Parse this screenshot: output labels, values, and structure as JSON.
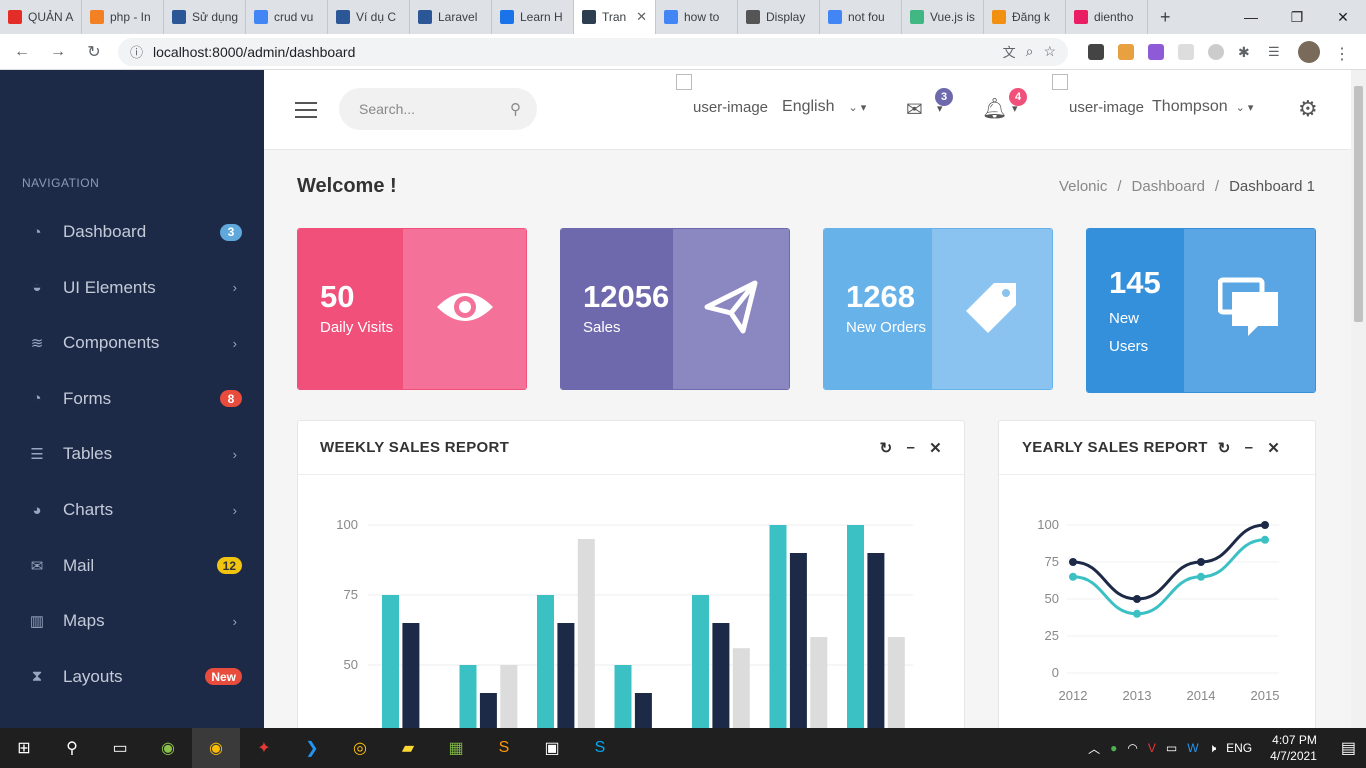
{
  "browser": {
    "tabs": [
      {
        "label": "QUẢN A",
        "color": "#e52d27"
      },
      {
        "label": "php - In",
        "color": "#f48024"
      },
      {
        "label": "Sử dụng",
        "color": "#2b5797"
      },
      {
        "label": "crud vu",
        "color": "#4285f4"
      },
      {
        "label": "Ví dụ C",
        "color": "#2b5797"
      },
      {
        "label": "Laravel",
        "color": "#2b5797"
      },
      {
        "label": "Learn H",
        "color": "#1a73e8"
      },
      {
        "label": "Tran",
        "color": "#2c3e50",
        "active": true
      },
      {
        "label": "how to",
        "color": "#4285f4"
      },
      {
        "label": "Display",
        "color": "#555555"
      },
      {
        "label": "not fou",
        "color": "#4285f4"
      },
      {
        "label": "Vue.js is",
        "color": "#41b883"
      },
      {
        "label": "Đăng k",
        "color": "#f29111"
      },
      {
        "label": "dientho",
        "color": "#e91e63"
      }
    ],
    "url": "localhost:8000/admin/dashboard"
  },
  "sidebar": {
    "section_label": "NAVIGATION",
    "items": [
      {
        "label": "Dashboard",
        "icon": "dashboard-icon",
        "glyph": "◔",
        "badge": "3",
        "badge_color": "#5fa8dc",
        "chev": ""
      },
      {
        "label": "UI Elements",
        "icon": "basket-icon",
        "glyph": "◒",
        "badge": "",
        "chev": "›"
      },
      {
        "label": "Components",
        "icon": "layers-icon",
        "glyph": "≋",
        "badge": "",
        "chev": "›"
      },
      {
        "label": "Forms",
        "icon": "dashboard-icon",
        "glyph": "◔",
        "badge": "8",
        "badge_color": "#e74c3c",
        "chev": ""
      },
      {
        "label": "Tables",
        "icon": "list-icon",
        "glyph": "☰",
        "badge": "",
        "chev": "›"
      },
      {
        "label": "Charts",
        "icon": "pie-chart-icon",
        "glyph": "◕",
        "badge": "",
        "chev": "›"
      },
      {
        "label": "Mail",
        "icon": "mail-icon",
        "glyph": "✉",
        "badge": "12",
        "badge_color": "#f1c40f",
        "badge_text_color": "#333333",
        "chev": ""
      },
      {
        "label": "Maps",
        "icon": "map-icon",
        "glyph": "▥",
        "badge": "",
        "chev": "›"
      },
      {
        "label": "Layouts",
        "icon": "hourglass-icon",
        "glyph": "⧗",
        "badge": "New",
        "badge_color": "#e74c3c",
        "chev": ""
      }
    ]
  },
  "topbar": {
    "search_placeholder": "Search...",
    "lang_img_alt": "user-image",
    "language": "English",
    "mail_count": "3",
    "notif_count": "4",
    "user_img_alt": "user-image",
    "user_name": "Thompson"
  },
  "page": {
    "title": "Welcome !",
    "breadcrumb": [
      "Velonic",
      "Dashboard",
      "Dashboard 1"
    ]
  },
  "stats": [
    {
      "value": "50",
      "label": "Daily Visits",
      "icon": "eye-icon",
      "dark": "#f0507a",
      "light": "#f47299"
    },
    {
      "value": "12056",
      "label": "Sales",
      "icon": "paper-plane-icon",
      "dark": "#6e69ad",
      "light": "#8b87c0"
    },
    {
      "value": "1268",
      "label": "New Orders",
      "icon": "tag-icon",
      "dark": "#68b2ea",
      "light": "#8ac3ef"
    },
    {
      "value": "145",
      "label": "New Users",
      "icon": "chat-icon",
      "dark": "#3590dc",
      "light": "#5aa5e3"
    }
  ],
  "weekly": {
    "title": "WEEKLY SALES REPORT",
    "chart_data": {
      "type": "bar",
      "yticks": [
        100,
        75,
        50
      ],
      "ylim": [
        0,
        100
      ],
      "colors": [
        "#3bc0c3",
        "#1d2a47",
        "#dcdcdc"
      ],
      "series": [
        {
          "values": [
            75,
            50,
            75,
            50,
            75,
            100,
            100
          ]
        },
        {
          "values": [
            65,
            40,
            65,
            40,
            65,
            90,
            90
          ]
        },
        {
          "values": [
            null,
            50,
            95,
            null,
            56,
            60,
            60
          ]
        }
      ]
    }
  },
  "yearly": {
    "title": "YEARLY SALES REPORT",
    "chart_data": {
      "type": "line",
      "categories": [
        "2012",
        "2013",
        "2014",
        "2015"
      ],
      "yticks": [
        100,
        75,
        50,
        25,
        0
      ],
      "ylim": [
        0,
        100
      ],
      "series": [
        {
          "values": [
            75,
            50,
            75,
            100
          ],
          "color": "#1d2a47"
        },
        {
          "values": [
            65,
            40,
            65,
            90
          ],
          "color": "#3bc0c3"
        }
      ]
    }
  },
  "taskbar": {
    "time": "4:07 PM",
    "date": "4/7/2021",
    "lang": "ENG"
  }
}
